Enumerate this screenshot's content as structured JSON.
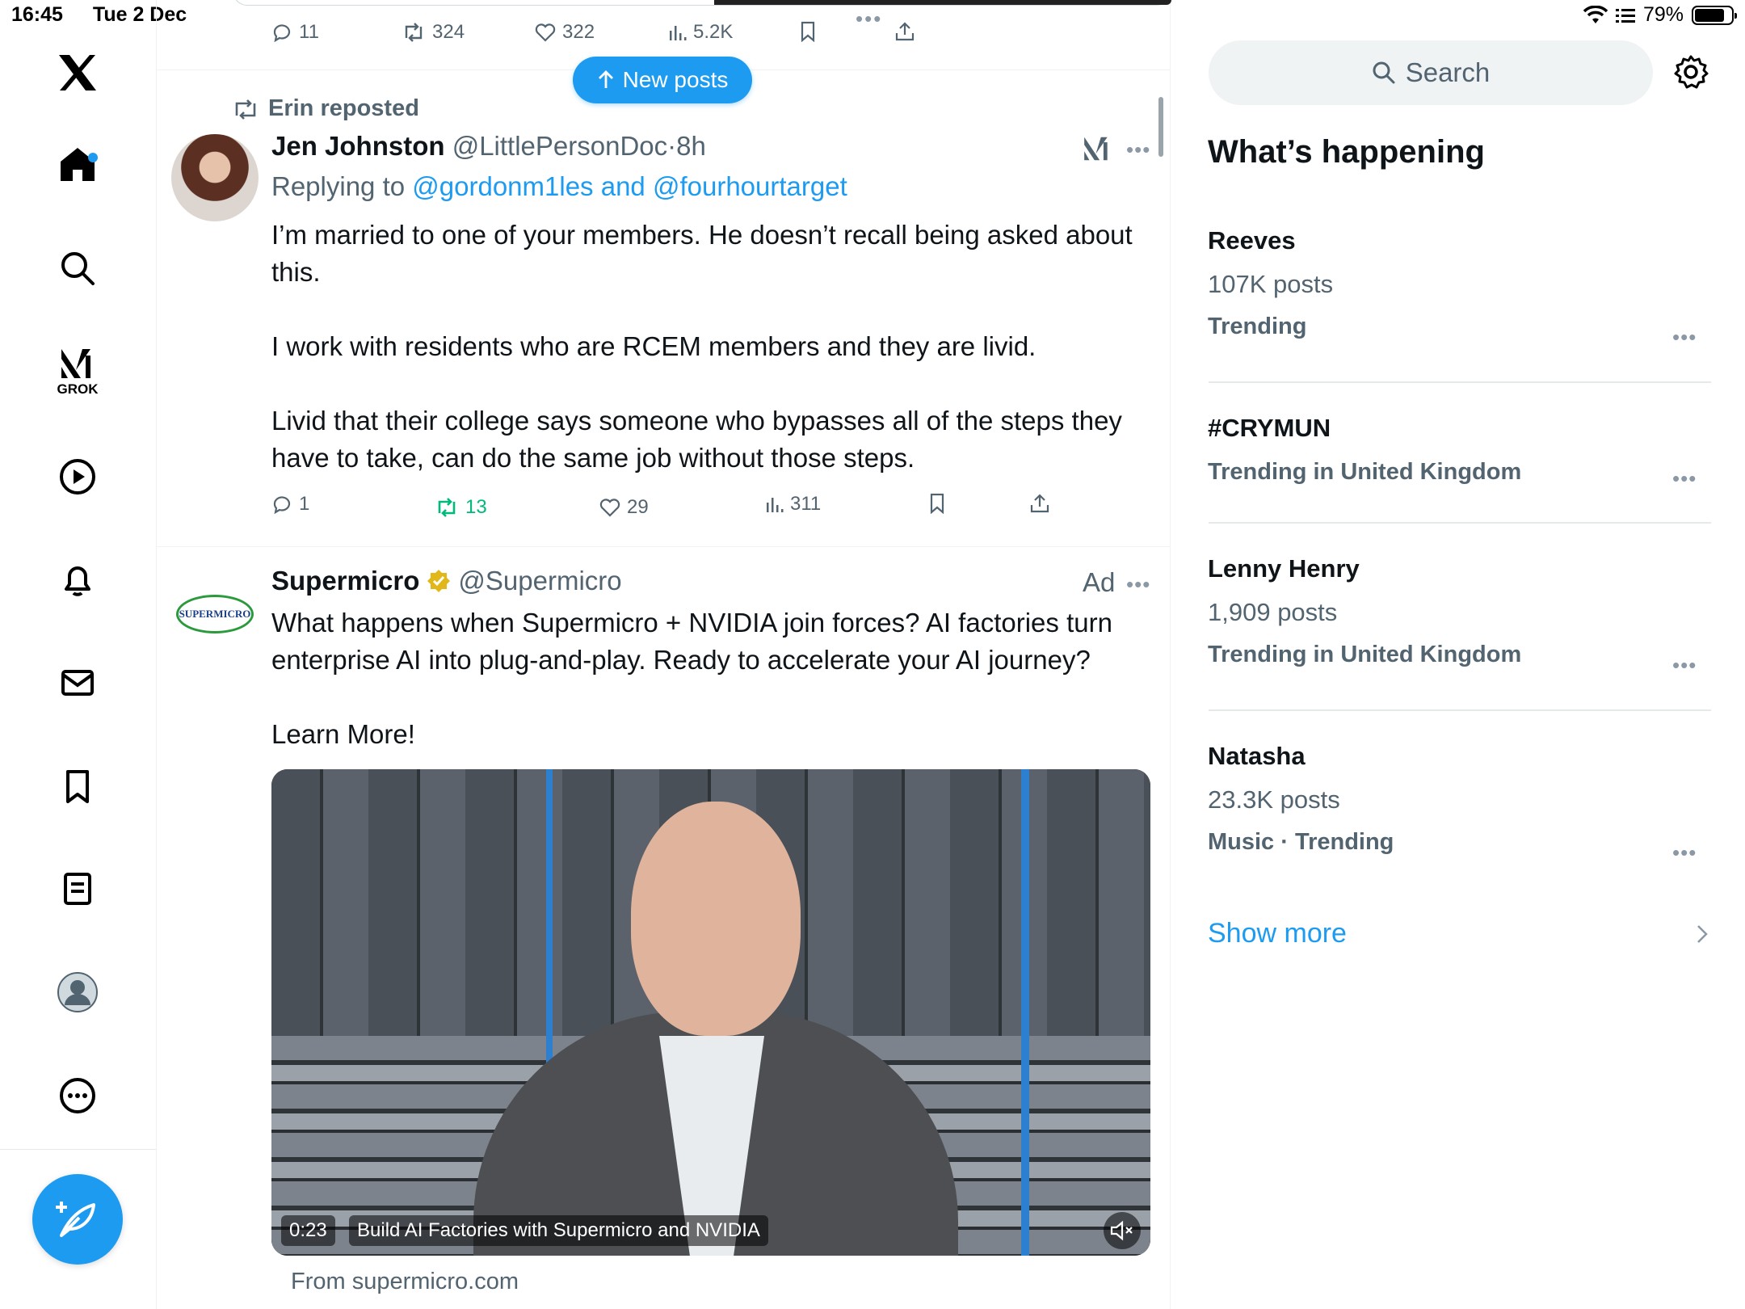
{
  "status_bar": {
    "time": "16:45",
    "date": "Tue 2 Dec",
    "battery": "79%"
  },
  "nav": {
    "grok_label": "GROK"
  },
  "feed": {
    "top_post_actions": {
      "replies": "11",
      "reposts": "324",
      "likes": "322",
      "views": "5.2K"
    },
    "new_posts_label": "New posts",
    "post1": {
      "repost_label": "Erin reposted",
      "author_name": "Jen Johnston",
      "handle": "@LittlePersonDoc",
      "separator": "·",
      "time": "8h",
      "replying_prefix": "Replying to",
      "replying_to": "@gordonm1les and @fourhourtarget",
      "text": "I’m married to one of your members. He doesn’t recall being asked about this.\n\nI work with residents who are RCEM members and they are livid.\n\nLivid that their college says someone who bypasses all of the steps they have to take, can do the same job without those steps.",
      "replies": "1",
      "reposts": "13",
      "likes": "29",
      "views": "311"
    },
    "post2": {
      "author_name": "Supermicro",
      "handle": "@Supermicro",
      "ad_label": "Ad",
      "avatar_logo_text": "SUPERMICRO",
      "text": "What happens when Supermicro + NVIDIA join forces? AI factories turn enterprise AI into plug-and-play. Ready to accelerate your AI journey?\n\nLearn More!",
      "video_time": "0:23",
      "video_title": "Build AI Factories with Supermicro and NVIDIA",
      "source": "From supermicro.com"
    }
  },
  "sidebar": {
    "search_placeholder": "Search",
    "heading": "What’s happening",
    "trends": [
      {
        "title": "Reeves",
        "posts": "107K posts",
        "meta": "Trending"
      },
      {
        "title": "#CRYMUN",
        "posts": "",
        "meta": "Trending in United Kingdom"
      },
      {
        "title": "Lenny Henry",
        "posts": "1,909 posts",
        "meta": "Trending in United Kingdom"
      },
      {
        "title": "Natasha",
        "posts": "23.3K posts",
        "meta": "Music · Trending"
      }
    ],
    "show_more": "Show more"
  },
  "colors": {
    "accent": "#1d9bf0",
    "repost_green": "#00ba7c",
    "verified_gold": "#e2b719"
  }
}
